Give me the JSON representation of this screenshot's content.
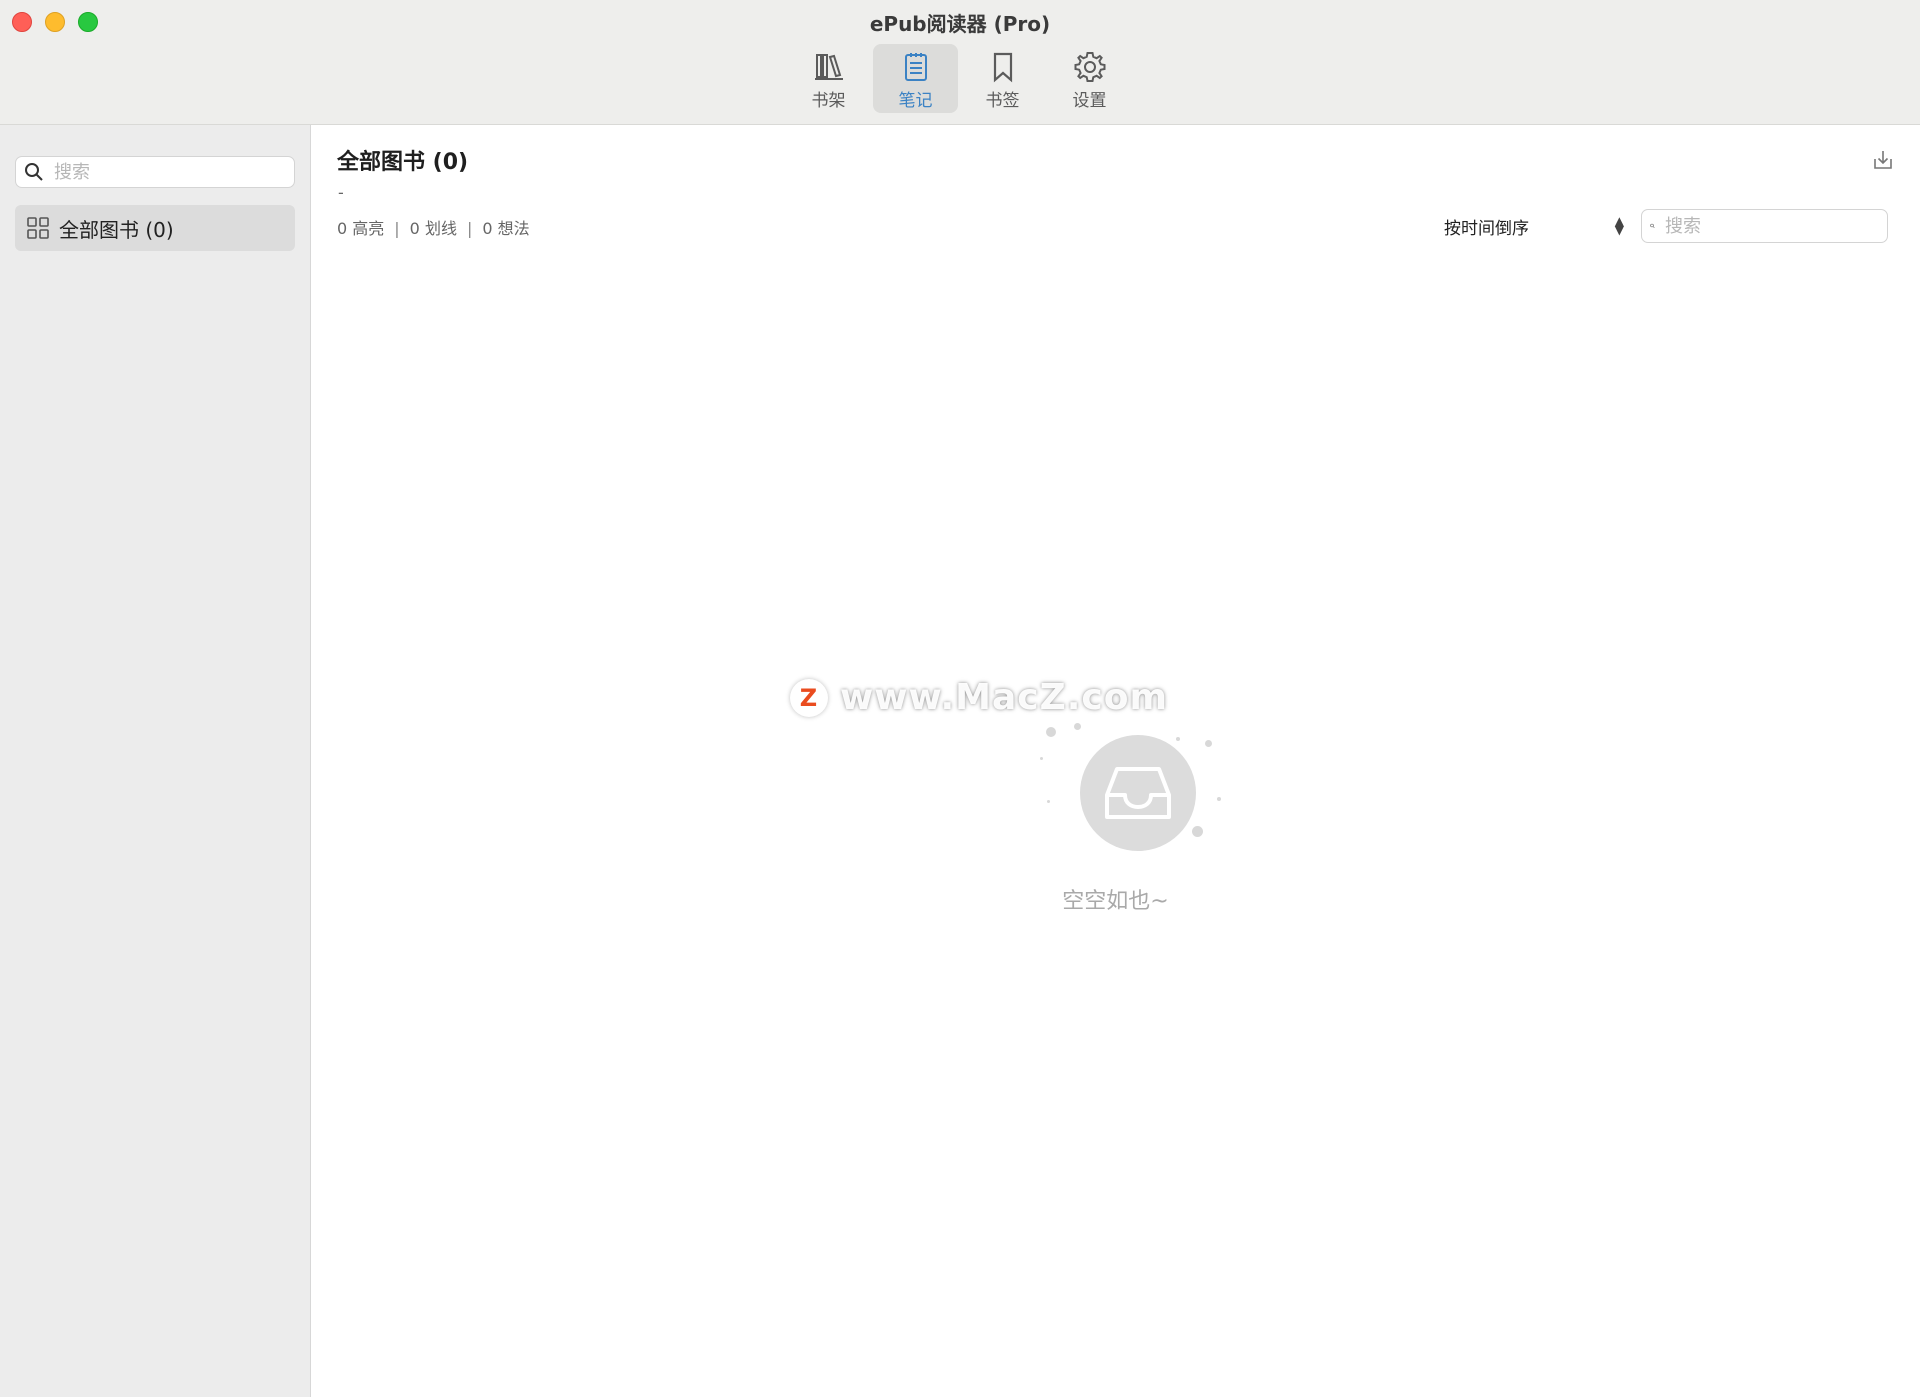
{
  "window": {
    "title": "ePub阅读器 (Pro)"
  },
  "toolbar": {
    "items": [
      {
        "label": "书架",
        "icon": "bookshelf-icon",
        "active": false
      },
      {
        "label": "笔记",
        "icon": "notes-icon",
        "active": true
      },
      {
        "label": "书签",
        "icon": "bookmark-icon",
        "active": false
      },
      {
        "label": "设置",
        "icon": "gear-icon",
        "active": false
      }
    ],
    "accent_color": "#3b82c4"
  },
  "sidebar": {
    "search_placeholder": "搜索",
    "items": [
      {
        "label": "全部图书 (0)",
        "icon": "grid-icon",
        "selected": true
      }
    ]
  },
  "main": {
    "title": "全部图书 (0)",
    "subtitle": "-",
    "stats": {
      "highlights": "0 高亮",
      "underlines": "0 划线",
      "thoughts": "0 想法",
      "separator": "|"
    },
    "sort_label": "按时间倒序",
    "search_placeholder": "搜索",
    "empty_text": "空空如也~"
  },
  "watermark": {
    "text": "www.MacZ.com",
    "logo_letter": "Z"
  }
}
